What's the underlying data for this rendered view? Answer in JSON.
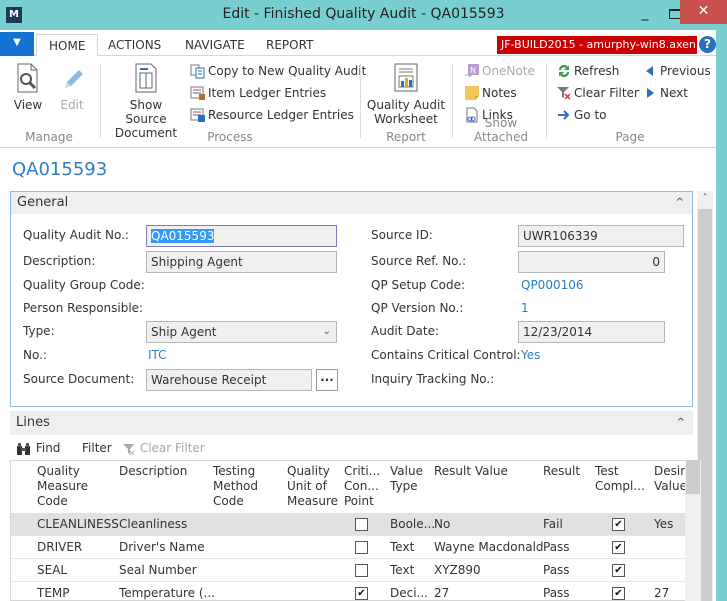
{
  "window": {
    "title": "Edit - Finished Quality Audit - QA015593",
    "logo": "M",
    "minimize": "_",
    "close": "✕"
  },
  "tabs": {
    "menu_arrow": "▼",
    "items": [
      "HOME",
      "ACTIONS",
      "NAVIGATE",
      "REPORT"
    ],
    "server_badge": "JF-BUILD2015 - amurphy-win8.axen...",
    "help": "?"
  },
  "ribbon": {
    "groups": {
      "manage": "Manage",
      "process": "Process",
      "report": "Report",
      "show_attached": "Show Attached",
      "page": "Page"
    },
    "view": "View",
    "edit": "Edit",
    "show_source_document_1": "Show Source",
    "show_source_document_2": "Document",
    "copy_to_new": "Copy to New Quality Audit",
    "item_ledger": "Item Ledger Entries",
    "resource_ledger": "Resource Ledger Entries",
    "qa_worksheet_1": "Quality Audit",
    "qa_worksheet_2": "Worksheet",
    "onenote": "OneNote",
    "notes": "Notes",
    "links": "Links",
    "refresh": "Refresh",
    "clear_filter": "Clear Filter",
    "go_to": "Go to",
    "previous": "Previous",
    "next": "Next"
  },
  "page": {
    "heading": "QA015593"
  },
  "general": {
    "title": "General",
    "collapse": "^",
    "fields": {
      "quality_audit_no_label": "Quality Audit No.:",
      "quality_audit_no": "QA015593",
      "description_label": "Description:",
      "description": "Shipping Agent",
      "quality_group_code_label": "Quality Group Code:",
      "person_responsible_label": "Person Responsible:",
      "type_label": "Type:",
      "type": "Ship Agent",
      "no_label": "No.:",
      "no": "ITC",
      "source_document_label": "Source Document:",
      "source_document": "Warehouse Receipt",
      "source_document_lookup": "...",
      "source_id_label": "Source ID:",
      "source_id": "UWR106339",
      "source_ref_no_label": "Source Ref. No.:",
      "source_ref_no": "0",
      "qp_setup_code_label": "QP Setup Code:",
      "qp_setup_code": "QP000106",
      "qp_version_no_label": "QP Version No.:",
      "qp_version_no": "1",
      "audit_date_label": "Audit Date:",
      "audit_date": "12/23/2014",
      "contains_critical_control_label": "Contains Critical Control:",
      "contains_critical_control": "Yes",
      "inquiry_tracking_no_label": "Inquiry Tracking No.:"
    }
  },
  "lines": {
    "title": "Lines",
    "collapse": "^",
    "toolbar": {
      "find": "Find",
      "filter": "Filter",
      "clear_filter": "Clear Filter"
    },
    "columns": [
      "Quality\nMeasure\nCode",
      "Description",
      "Testing\nMethod\nCode",
      "Quality\nUnit of\nMeasure",
      "Criti...\nCon...\nPoint",
      "Value\nType",
      "Result Value",
      "Result",
      "Test\nCompl...",
      "Desired\nValue"
    ],
    "rows": [
      {
        "code": "CLEANLINESS",
        "description": "Cleanliness",
        "testing_method": "",
        "uom": "",
        "critical": false,
        "value_type": "Boole...",
        "result_value": "No",
        "result": "Fail",
        "test_complete": true,
        "desired": "Yes",
        "selected": true
      },
      {
        "code": "DRIVER",
        "description": "Driver's Name",
        "testing_method": "",
        "uom": "",
        "critical": false,
        "value_type": "Text",
        "result_value": "Wayne Macdonald",
        "result": "Pass",
        "test_complete": true,
        "desired": "",
        "selected": false
      },
      {
        "code": "SEAL",
        "description": "Seal Number",
        "testing_method": "",
        "uom": "",
        "critical": false,
        "value_type": "Text",
        "result_value": "XYZ890",
        "result": "Pass",
        "test_complete": true,
        "desired": "",
        "selected": false
      },
      {
        "code": "TEMP",
        "description": "Temperature (...",
        "testing_method": "",
        "uom": "",
        "critical": true,
        "value_type": "Deci...",
        "result_value": "27",
        "result": "Pass",
        "test_complete": true,
        "desired": "27",
        "selected": false
      }
    ]
  },
  "colors": {
    "accent": "#2d7bc9",
    "titlebar": "#79cfd0",
    "server_badge": "#cc0000",
    "close": "#c7504f"
  }
}
